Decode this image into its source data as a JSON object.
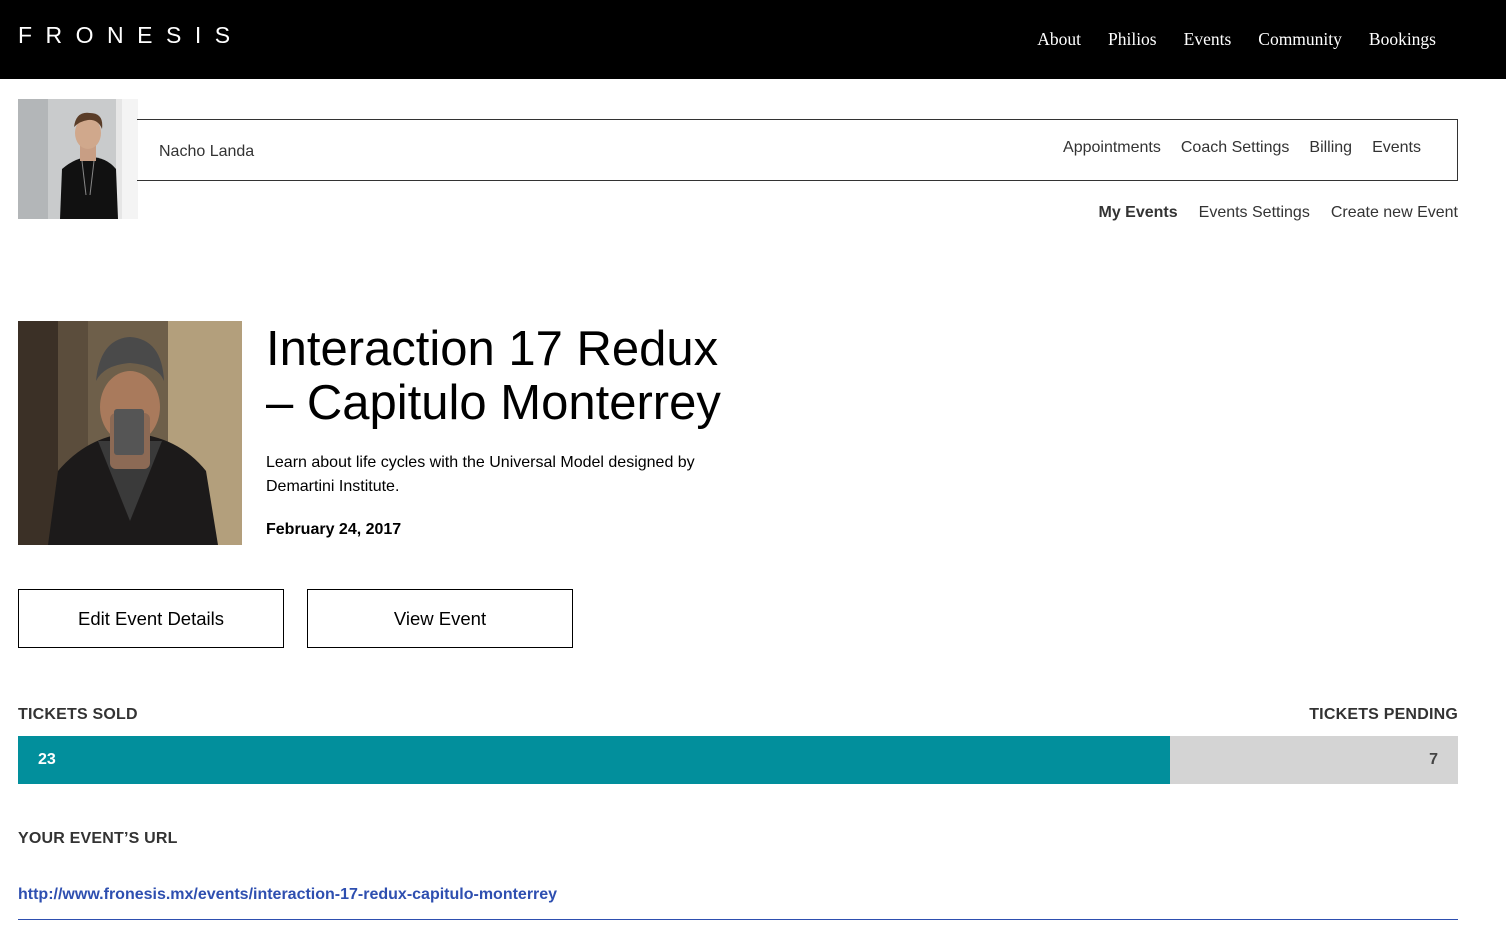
{
  "brand": {
    "logo": "FRONESIS"
  },
  "main_nav": [
    "About",
    "Philios",
    "Events",
    "Community",
    "Bookings"
  ],
  "profile": {
    "name": "Nacho Landa",
    "nav": [
      "Appointments",
      "Coach Settings",
      "Billing",
      "Events"
    ]
  },
  "sub_nav": {
    "items": [
      "My Events",
      "Events Settings",
      "Create new Event"
    ],
    "active": "My Events"
  },
  "event": {
    "title": "Interaction 17 Redux – Capitulo Monterrey",
    "description": "Learn about life cycles with the Universal Model designed by Demartini Institute.",
    "date": "February 24, 2017"
  },
  "buttons": {
    "edit": "Edit Event Details",
    "view": "View Event"
  },
  "tickets": {
    "sold_label": "TICKETS SOLD",
    "pending_label": "TICKETS PENDING",
    "sold": "23",
    "pending": "7",
    "sold_fraction": 0.8,
    "sold_color": "#028f9c",
    "pending_color": "#d4d4d4"
  },
  "url_section": {
    "label": "YOUR EVENT’S URL",
    "url": "http://www.fronesis.mx/events/interaction-17-redux-capitulo-monterrey",
    "link_color": "#2e4fb0"
  }
}
